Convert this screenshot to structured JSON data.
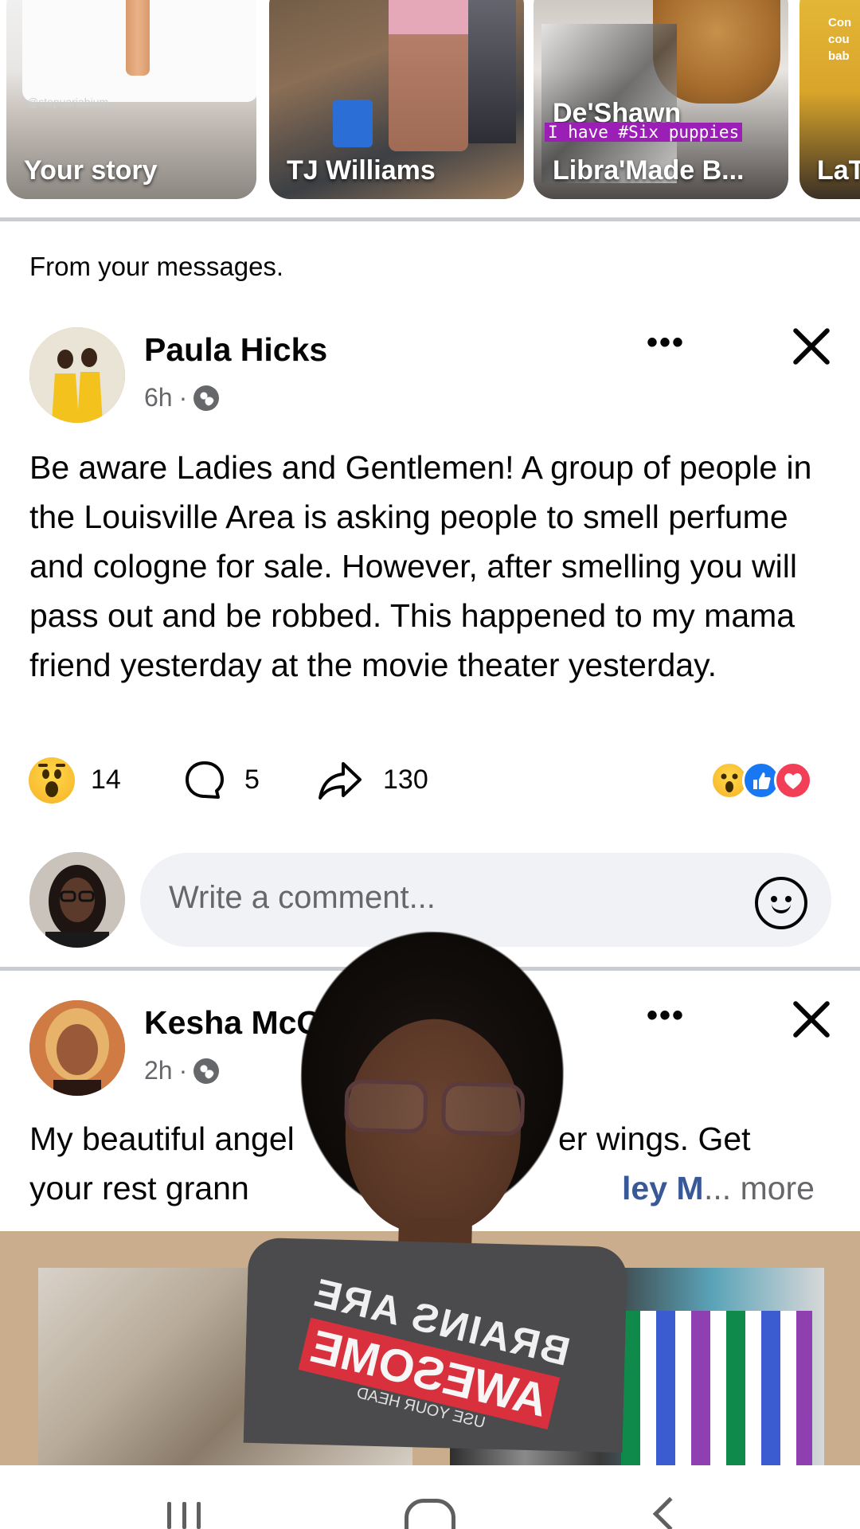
{
  "stories": [
    {
      "label": "Your story",
      "handle": "@stepuariabium"
    },
    {
      "label": "TJ Williams"
    },
    {
      "label": "Libra'Made B...",
      "name_line": "De'Shawn",
      "overlay_text": "I have #Six puppies"
    },
    {
      "label": "LaT",
      "overlay_text": "Con cou bab"
    }
  ],
  "section_label": "From your messages.",
  "posts": [
    {
      "author": "Paula Hicks",
      "time": "6h",
      "text": "Be aware Ladies and Gentlemen! A group of people in the Louisville Area is asking people to smell perfume and cologne for sale.  However, after smelling you will pass out and be robbed. This happened to my mama friend yesterday at the movie theater yesterday.",
      "reaction_count": "14",
      "comment_count": "5",
      "share_count": "130",
      "comment_placeholder": "Write a comment..."
    },
    {
      "author": "Kesha McC",
      "time": "2h",
      "text_line1_a": "My beautiful angel",
      "text_line1_b": "er wings. Get",
      "text_line2_a": "your rest grann",
      "text_line2_b": "ley M",
      "more_label": "... more"
    }
  ],
  "overlay_shirt": {
    "line1": "BRAINS ARE",
    "line2": "AWESOME",
    "line3": "USE YOUR HEAD"
  },
  "colors": {
    "link": "#385898",
    "wow": "#f6b126",
    "like": "#1877f2",
    "love": "#f33e58",
    "muted": "#65676b"
  }
}
